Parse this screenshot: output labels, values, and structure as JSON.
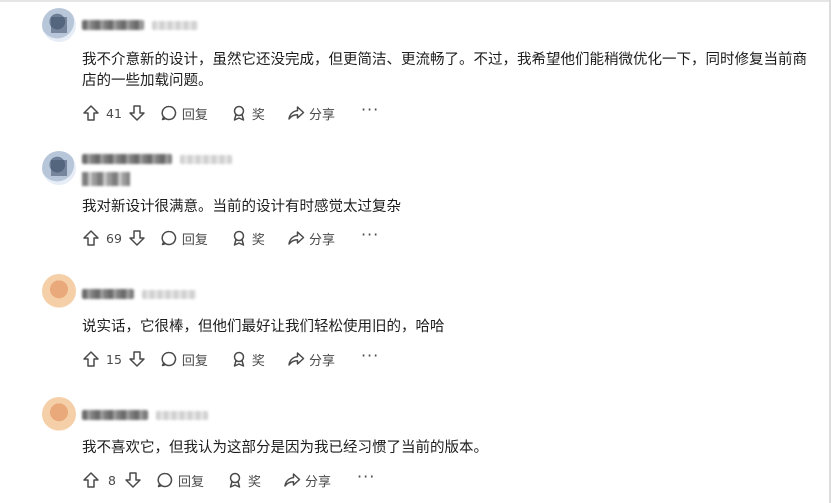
{
  "comments": [
    {
      "text": "我不介意新的设计，虽然它还没完成，但更简洁、更流畅了。不过，我希望他们能稍微优化一下，同时修复当前商店的一些加载问题。",
      "votes": "41",
      "reply_label": "回复",
      "award_label": "奖",
      "share_label": "分享",
      "more_label": "···"
    },
    {
      "text": "我对新设计很满意。当前的设计有时感觉太过复杂",
      "votes": "69",
      "reply_label": "回复",
      "award_label": "奖",
      "share_label": "分享",
      "more_label": "···"
    },
    {
      "text": "说实话，它很棒，但他们最好让我们轻松使用旧的，哈哈",
      "votes": "15",
      "reply_label": "回复",
      "award_label": "奖",
      "share_label": "分享",
      "more_label": "···"
    },
    {
      "text": "我不喜欢它，但我认为这部分是因为我已经习惯了当前的版本。",
      "votes": "8",
      "reply_label": "回复",
      "award_label": "奖",
      "share_label": "分享",
      "more_label": "···"
    }
  ],
  "icons": {
    "upvote": "arrow-up-icon",
    "downvote": "arrow-down-icon",
    "reply": "speech-bubble-icon",
    "award": "award-icon",
    "share": "share-arrow-icon"
  }
}
